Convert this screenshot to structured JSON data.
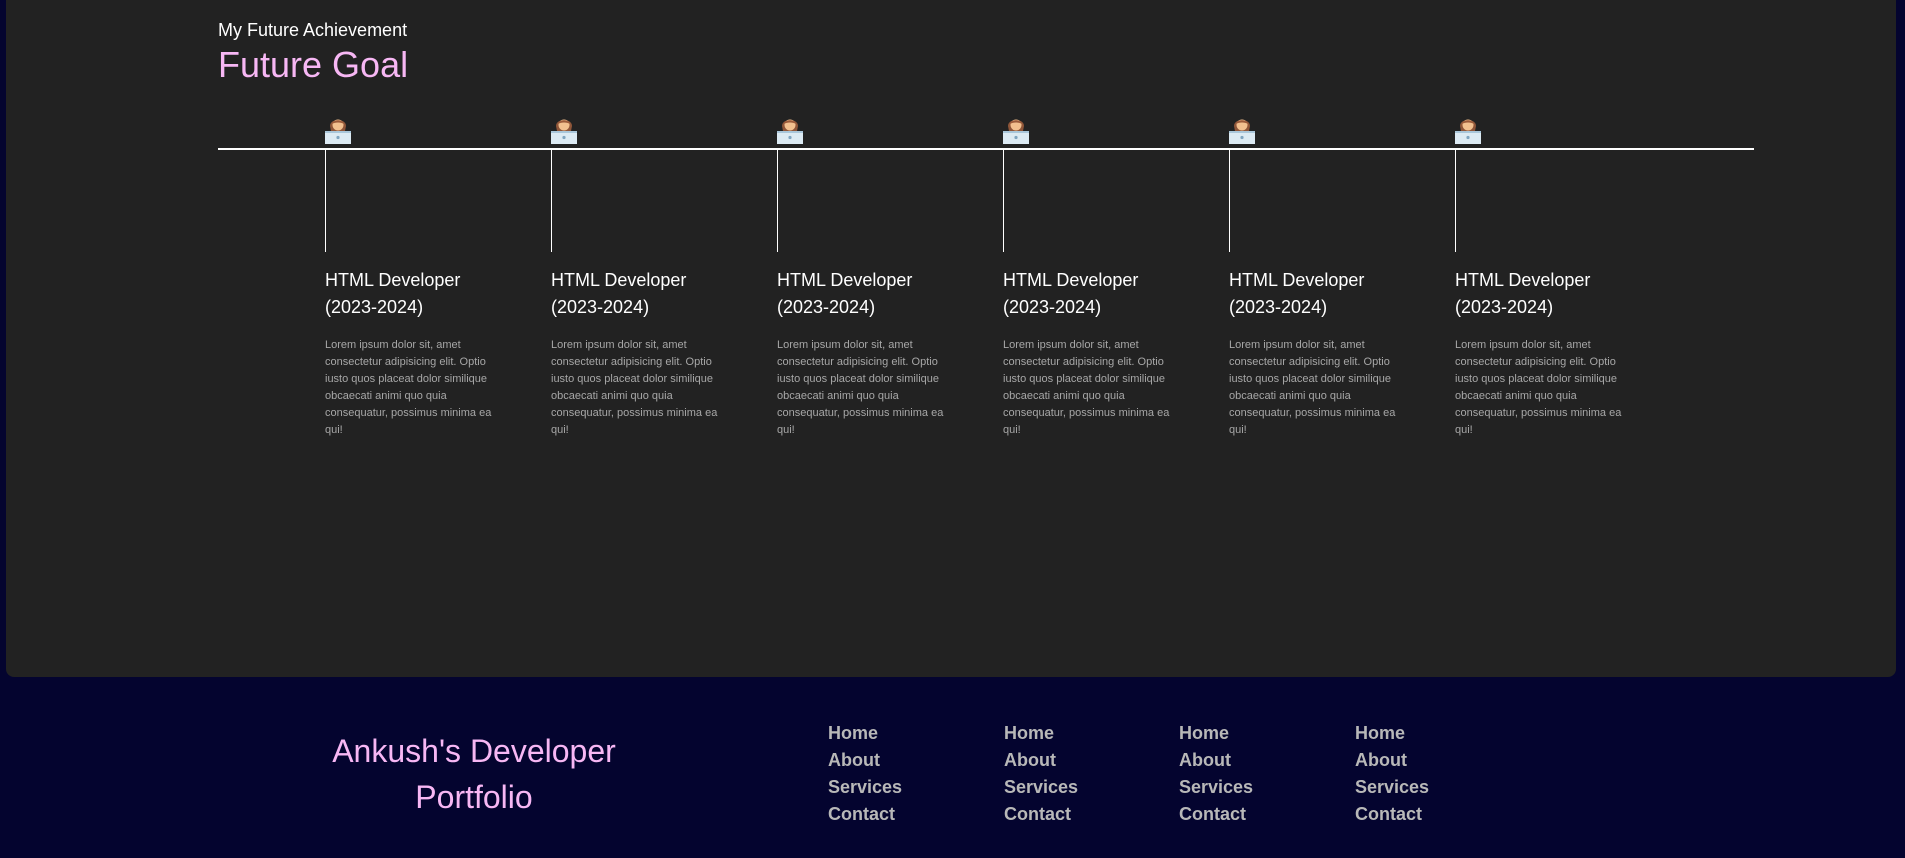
{
  "page": {
    "kicker": "My Future Achievement",
    "heading": "Future Goal"
  },
  "timeline": {
    "items": [
      {
        "title_line1": "HTML Developer",
        "title_line2": "(2023-2024)",
        "text": "Lorem ipsum dolor sit, amet consectetur adipisicing elit. Optio iusto quos placeat dolor similique obcaecati animi quo quia consequatur, possimus minima ea qui!",
        "icon": "person-at-laptop-icon"
      },
      {
        "title_line1": "HTML Developer",
        "title_line2": "(2023-2024)",
        "text": "Lorem ipsum dolor sit, amet consectetur adipisicing elit. Optio iusto quos placeat dolor similique obcaecati animi quo quia consequatur, possimus minima ea qui!",
        "icon": "person-at-laptop-icon"
      },
      {
        "title_line1": "HTML Developer",
        "title_line2": "(2023-2024)",
        "text": "Lorem ipsum dolor sit, amet consectetur adipisicing elit. Optio iusto quos placeat dolor similique obcaecati animi quo quia consequatur, possimus minima ea qui!",
        "icon": "person-at-laptop-icon"
      },
      {
        "title_line1": "HTML Developer",
        "title_line2": "(2023-2024)",
        "text": "Lorem ipsum dolor sit, amet consectetur adipisicing elit. Optio iusto quos placeat dolor similique obcaecati animi quo quia consequatur, possimus minima ea qui!",
        "icon": "person-at-laptop-icon"
      },
      {
        "title_line1": "HTML Developer",
        "title_line2": "(2023-2024)",
        "text": "Lorem ipsum dolor sit, amet consectetur adipisicing elit. Optio iusto quos placeat dolor similique obcaecati animi quo quia consequatur, possimus minima ea qui!",
        "icon": "person-at-laptop-icon"
      },
      {
        "title_line1": "HTML Developer",
        "title_line2": "(2023-2024)",
        "text": "Lorem ipsum dolor sit, amet consectetur adipisicing elit. Optio iusto quos placeat dolor similique obcaecati animi quo quia consequatur, possimus minima ea qui!",
        "icon": "person-at-laptop-icon"
      }
    ]
  },
  "footer": {
    "brand": "Ankush's Developer Portfolio",
    "columns": [
      {
        "links": [
          "Home",
          "About",
          "Services",
          "Contact"
        ]
      },
      {
        "links": [
          "Home",
          "About",
          "Services",
          "Contact"
        ]
      },
      {
        "links": [
          "Home",
          "About",
          "Services",
          "Contact"
        ]
      },
      {
        "links": [
          "Home",
          "About",
          "Services",
          "Contact"
        ]
      }
    ]
  },
  "colors": {
    "card_bg": "#222222",
    "footer_bg": "#04042f",
    "accent_pink": "#f7b7f4",
    "muted_text": "#a7a7a7",
    "footer_link": "#b8b8b8"
  }
}
